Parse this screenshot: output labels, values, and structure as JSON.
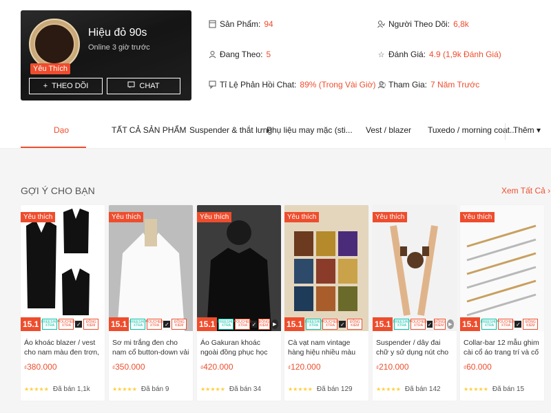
{
  "shop": {
    "name": "Hiệu đỏ 90s",
    "online": "Online 3 giờ trước",
    "badge": "Yêu Thích",
    "follow_label": "THEO DÕI",
    "chat_label": "CHAT",
    "colors": {
      "accent": "#ee4d2d"
    }
  },
  "stats": {
    "products_label": "Sản Phẩm:",
    "products_value": "94",
    "following_label": "Đang Theo:",
    "following_value": "5",
    "chat_rate_label": "Tỉ Lệ Phản Hồi Chat:",
    "chat_rate_value": "89% (Trong Vài Giờ)",
    "followers_label": "Người Theo Dõi:",
    "followers_value": "6,8k",
    "rating_label": "Đánh Giá:",
    "rating_value": "4.9 (1,9k Đánh Giá)",
    "joined_label": "Tham Gia:",
    "joined_value": "7 Năm Trước"
  },
  "tabs": [
    {
      "label": "Dạo"
    },
    {
      "label": "TẤT CẢ SẢN PHẨM"
    },
    {
      "label": "Suspender & thắt lưng"
    },
    {
      "label": "Phụ liệu may mặc (sti..."
    },
    {
      "label": "Vest / blazer"
    },
    {
      "label": "Tuxedo / morning coat..."
    },
    {
      "label": "Thêm ▾"
    }
  ],
  "section": {
    "title": "GỢI Ý CHO BẠN",
    "see_all": "Xem Tất Cả ›"
  },
  "products": [
    {
      "badge": "Yêu thích",
      "name": "Áo khoác blazer / vest cho nam màu đen trơn, xanh navy slim ...",
      "currency": "₫",
      "price": "380.000",
      "sold": "Đã bán 1,1k"
    },
    {
      "badge": "Yêu thích",
      "name": "Sơ mi trắng đen cho nam cổ button-down vải chống nhăn c...",
      "currency": "₫",
      "price": "350.000",
      "sold": "Đã bán 9"
    },
    {
      "badge": "Yêu thích",
      "name": "Áo Gakuran khoác ngoài đồng phục học sinh Nhật Bản thời x...",
      "currency": "₫",
      "price": "420.000",
      "sold": "Đã bán 34"
    },
    {
      "badge": "Yêu thích",
      "name": "Cà vạt nam vintage hàng hiệu nhiều màu xuất Italy, Pháp, M...",
      "currency": "₫",
      "price": "120.000",
      "sold": "Đã bán 129"
    },
    {
      "badge": "Yêu thích",
      "name": "Suspender / dây đai chữ y sử dụng nút cho nam / dây yếm đ...",
      "currency": "₫",
      "price": "210.000",
      "sold": "Đã bán 142"
    },
    {
      "badge": "Yêu thích",
      "name": "Collar-bar 12 mẫu ghim cài cổ áo trang trí và cố định cà vạt p...",
      "currency": "₫",
      "price": "60.000",
      "sold": "Đã bán 15"
    }
  ],
  "promo": {
    "num": "15.1",
    "freeship": "FREESHIP XTRA",
    "voucher": "VOUCHER XTRA",
    "dongkiem": "ĐỒNG KIỂM"
  }
}
